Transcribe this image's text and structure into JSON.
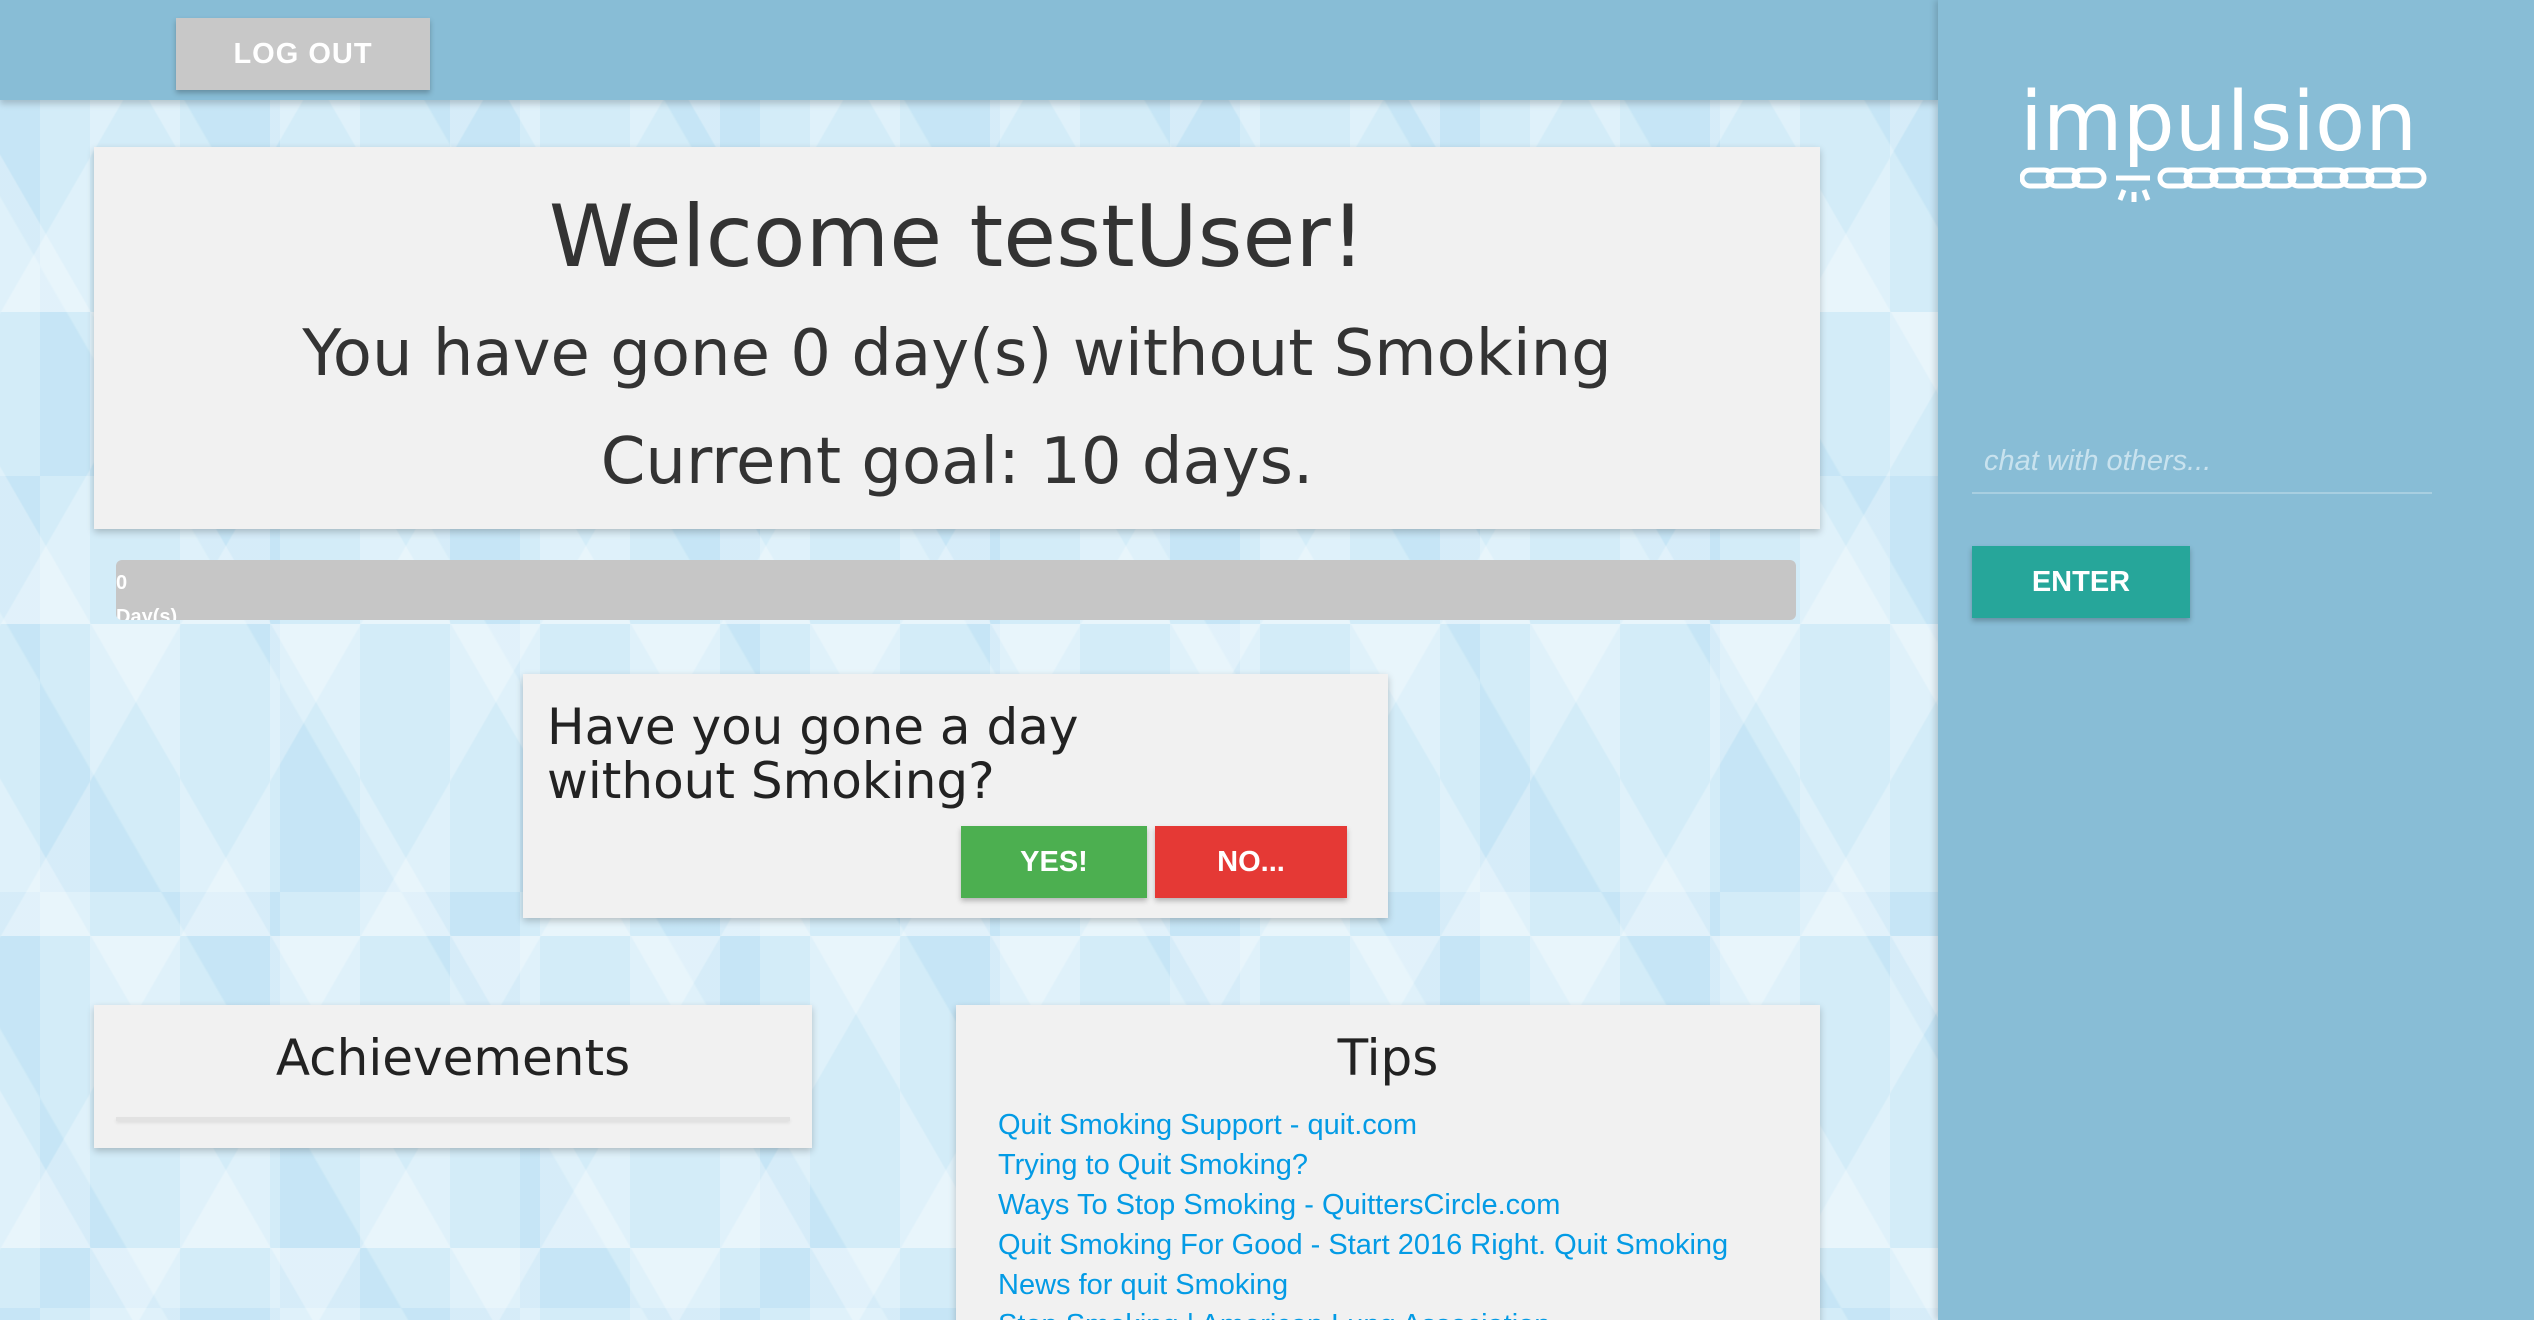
{
  "header": {
    "logout_label": "LOG OUT"
  },
  "welcome": {
    "title": "Welcome testUser!",
    "days_line": "You have gone 0 day(s) without Smoking",
    "goal_line": "Current goal: 10 days."
  },
  "progress": {
    "days_value": "0",
    "days_unit": "Day(s)",
    "fraction": 0
  },
  "question": {
    "text": "Have you gone a day without Smoking?",
    "yes_label": "YES!",
    "no_label": "NO..."
  },
  "achievements": {
    "title": "Achievements"
  },
  "tips": {
    "title": "Tips",
    "links": [
      "Quit Smoking Support - quit.com",
      "Trying to Quit Smoking?",
      "Ways To Stop Smoking - QuittersCircle.com",
      "Quit Smoking For Good - Start 2016 Right. Quit Smoking",
      "News for quit Smoking",
      "Stop Smoking | American Lung Association"
    ]
  },
  "sidebar": {
    "logo_text": "impulsion",
    "chat_placeholder": "chat with others...",
    "enter_label": "ENTER"
  },
  "colors": {
    "accent_teal": "#26a69a",
    "yes_green": "#4caf50",
    "no_red": "#e53935",
    "link_blue": "#039be5",
    "panel_blue": "#88bdd6"
  }
}
